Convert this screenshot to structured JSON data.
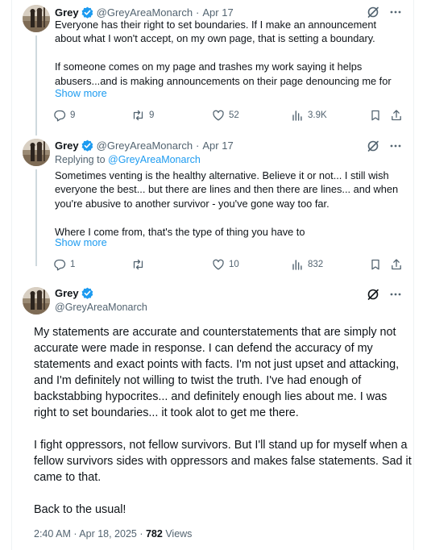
{
  "tweets": [
    {
      "name": "Grey",
      "handle": "@GreyAreaMonarch",
      "separator": "·",
      "date": "Apr 17",
      "text": "Everyone has their right to set boundaries. If I make an announcement about what I won't accept, on my own page, that is setting a boundary.\n\nIf someone comes on my page and trashes my work saying it helps abusers...and is making announcements on their page denouncing me for",
      "show_more": "Show more",
      "replies": "9",
      "reposts": "9",
      "likes": "52",
      "views": "3.9K"
    },
    {
      "name": "Grey",
      "handle": "@GreyAreaMonarch",
      "separator": "·",
      "date": "Apr 17",
      "replying_prefix": "Replying to ",
      "replying_to": "@GreyAreaMonarch",
      "text": "Sometimes venting is the healthy alternative. Believe it or not... I still wish everyone the best... but there are lines and then there are lines... and when you're abusive to another survivor - you've gone way too far.\n\nWhere I come from, that's the type of thing you have to",
      "show_more": "Show more",
      "replies": "1",
      "reposts": "",
      "likes": "10",
      "views": "832"
    }
  ],
  "main_tweet": {
    "name": "Grey",
    "handle": "@GreyAreaMonarch",
    "text": "My statements are accurate and counterstatements that are simply not accurate were made in response. I can defend the accuracy of my statements and exact points with facts. I'm not just upset and attacking, and I'm definitely not willing to twist the truth. I've had enough of backstabbing hypocrites... and definitely enough lies about me. I was right to set boundaries... it took alot to get me there.\n\nI fight oppressors, not fellow survivors. But I'll stand up for myself when a fellow survivors sides with oppressors and makes false statements. Sad it came to that.\n\nBack to the usual!",
    "time": "2:40 AM · Apr 18, 2025 · ",
    "views_count": "782",
    "views_label": " Views"
  },
  "colors": {
    "accent": "#1d9bf0",
    "secondary_text": "#536471",
    "primary_text": "#0f1419"
  },
  "icons": [
    "verified-badge-icon",
    "grok-icon",
    "more-icon",
    "reply-icon",
    "repost-icon",
    "like-icon",
    "views-icon",
    "bookmark-icon",
    "share-icon"
  ]
}
